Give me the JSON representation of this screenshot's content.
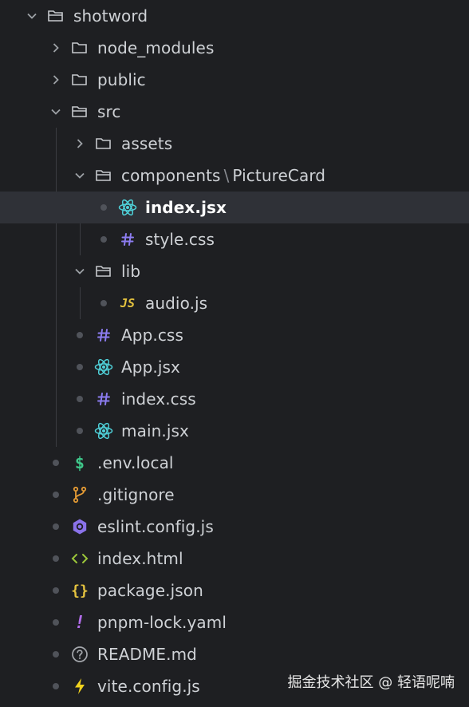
{
  "colors": {
    "background": "#1e1f22",
    "selected_row": "#2f3137",
    "folder_icon": "#c5c8cc",
    "react_icon": "#4fd1d9",
    "css_icon": "#8c7cf0",
    "js_icon": "#e5c33f",
    "env_icon": "#3fc88b",
    "git_icon": "#e59b35",
    "eslint_icon": "#8a72ea",
    "html_icon": "#9bc63a",
    "json_icon": "#e5c33f",
    "yaml_icon": "#b06ce8",
    "readme_icon": "#a4a7ac",
    "vite_icon": "#f0d21e"
  },
  "tree": {
    "root": {
      "label": "shotword",
      "icon": "folder-open-icon",
      "expanded": true
    },
    "node_modules": {
      "label": "node_modules",
      "icon": "folder-icon",
      "expanded": false
    },
    "public": {
      "label": "public",
      "icon": "folder-icon",
      "expanded": false
    },
    "src": {
      "label": "src",
      "icon": "folder-open-icon",
      "expanded": true
    },
    "assets": {
      "label": "assets",
      "icon": "folder-icon",
      "expanded": false
    },
    "components": {
      "label": "components",
      "sep": "\\",
      "sub": "PictureCard",
      "icon": "folder-open-icon",
      "expanded": true
    },
    "index_jsx": {
      "label": "index.jsx",
      "icon": "react-icon",
      "selected": true
    },
    "style_css": {
      "label": "style.css",
      "icon": "hash-icon"
    },
    "lib": {
      "label": "lib",
      "icon": "folder-open-icon",
      "expanded": true
    },
    "audio_js": {
      "label": "audio.js",
      "icon": "js-icon",
      "icon_text": "JS"
    },
    "app_css": {
      "label": "App.css",
      "icon": "hash-icon"
    },
    "app_jsx": {
      "label": "App.jsx",
      "icon": "react-icon"
    },
    "index_css": {
      "label": "index.css",
      "icon": "hash-icon"
    },
    "main_jsx": {
      "label": "main.jsx",
      "icon": "react-icon"
    },
    "env_local": {
      "label": ".env.local",
      "icon": "dollar-icon"
    },
    "gitignore": {
      "label": ".gitignore",
      "icon": "git-branch-icon"
    },
    "eslint": {
      "label": "eslint.config.js",
      "icon": "eslint-icon"
    },
    "index_html": {
      "label": "index.html",
      "icon": "html-brackets-icon"
    },
    "package_json": {
      "label": "package.json",
      "icon": "json-braces-icon"
    },
    "pnpm_lock": {
      "label": "pnpm-lock.yaml",
      "icon": "exclamation-icon"
    },
    "readme": {
      "label": "README.md",
      "icon": "question-circle-icon"
    },
    "vite_config": {
      "label": "vite.config.js",
      "icon": "lightning-icon"
    }
  },
  "watermark": "掘金技术社区 @ 轻语呢喃"
}
